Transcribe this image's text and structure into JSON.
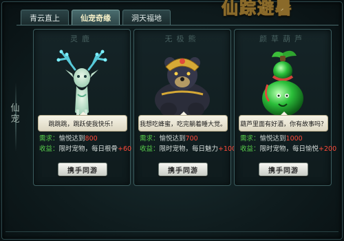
{
  "window": {
    "title": "仙宠"
  },
  "tabs": [
    {
      "label": "青云直上"
    },
    {
      "label": "仙宠奇缘"
    },
    {
      "label": "洞天福地"
    }
  ],
  "side_label": [
    "仙",
    "宠"
  ],
  "cards": [
    {
      "name": "灵鹿",
      "speech": "跳跳跳，跳跃使我快乐！",
      "req_key": "需求：",
      "req_text": "愉悦达到",
      "req_value": "800",
      "gain_key": "收益：",
      "gain_text": "限时宠物，每日根骨",
      "gain_value": "+60",
      "button": "携手同游"
    },
    {
      "name": "无极熊",
      "speech": "我想吃蜂蜜，吃完躺着睡大觉。",
      "req_key": "需求：",
      "req_text": "愉悦达到",
      "req_value": "700",
      "gain_key": "收益：",
      "gain_text": "限时宠物，每日魅力",
      "gain_value": "+100",
      "button": "携手同游"
    },
    {
      "name": "颜草葫芦",
      "speech": "葫芦里面有好酒，你有故事吗？",
      "req_key": "需求：",
      "req_text": "愉悦达到",
      "req_value": "1000",
      "gain_key": "收益：",
      "gain_text": "限时宠物，每日愉悦",
      "gain_value": "+200",
      "button": "携手同游"
    }
  ],
  "colors": {
    "accent_green": "#58d04b",
    "value_red": "#ff4a3a",
    "frame_border": "#3c5d5f"
  }
}
